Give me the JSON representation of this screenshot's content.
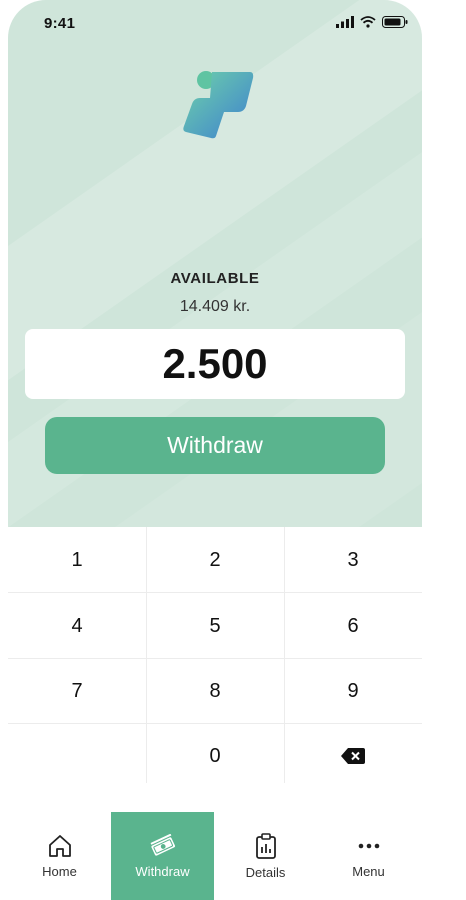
{
  "status_bar": {
    "time": "9:41"
  },
  "brand": {
    "accent_color": "#5ab48e",
    "hero_color": "#cfe5da"
  },
  "wallet": {
    "available_label": "AVAILABLE",
    "balance": "14.409 kr."
  },
  "withdrawal": {
    "amount": "2.500",
    "button_label": "Withdraw"
  },
  "keypad": {
    "keys": [
      "1",
      "2",
      "3",
      "4",
      "5",
      "6",
      "7",
      "8",
      "9",
      "",
      "0"
    ],
    "backspace_icon": "backspace-icon"
  },
  "nav": {
    "items": [
      {
        "label": "Home",
        "icon": "home-icon",
        "active": false
      },
      {
        "label": "Withdraw",
        "icon": "cash-icon",
        "active": true
      },
      {
        "label": "Details",
        "icon": "clipboard-icon",
        "active": false
      },
      {
        "label": "Menu",
        "icon": "more-icon",
        "active": false
      }
    ]
  }
}
